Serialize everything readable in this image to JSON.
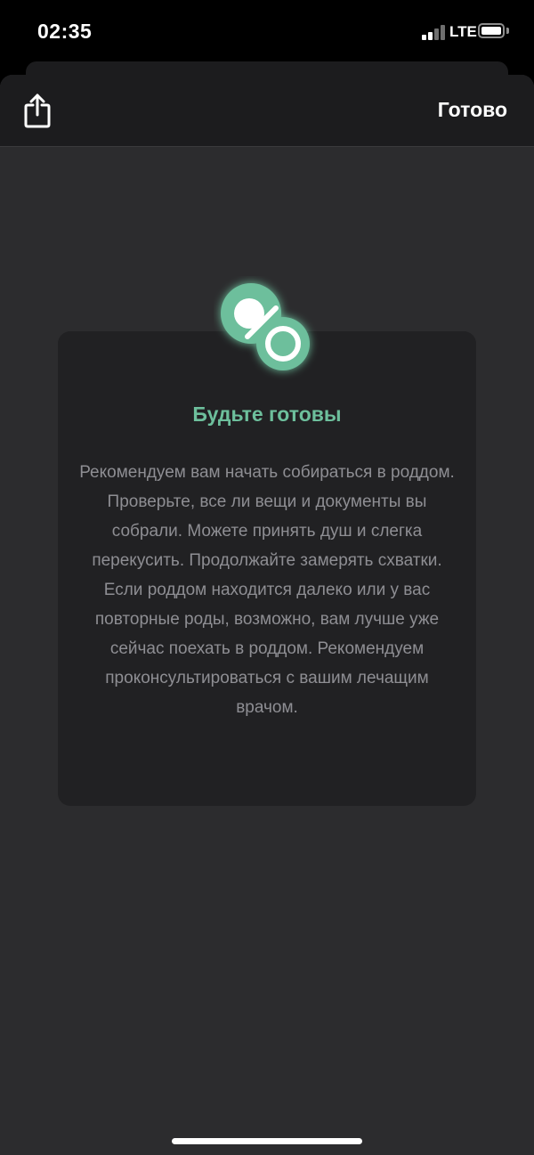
{
  "status_bar": {
    "time": "02:35",
    "network": "LTE",
    "signal_bars_active": 2,
    "signal_bars_total": 4
  },
  "header": {
    "share_icon": "share-icon",
    "done_label": "Готово"
  },
  "card": {
    "icon": "pacifier-icon",
    "title": "Будьте готовы",
    "body": "Рекомендуем вам начать собираться в роддом. Проверьте, все ли вещи и документы вы собрали. Можете принять душ и слегка перекусить. Продолжайте замерять схватки. Если роддом находится далеко или у вас повторные роды, возможно, вам лучше уже сейчас поехать в роддом. Рекомендуем проконсультироваться с вашим лечащим врачом."
  },
  "colors": {
    "accent": "#6dbf9c",
    "sheet_bg": "#2c2c2e",
    "card_bg": "#212123",
    "header_bg": "#1c1c1e"
  }
}
